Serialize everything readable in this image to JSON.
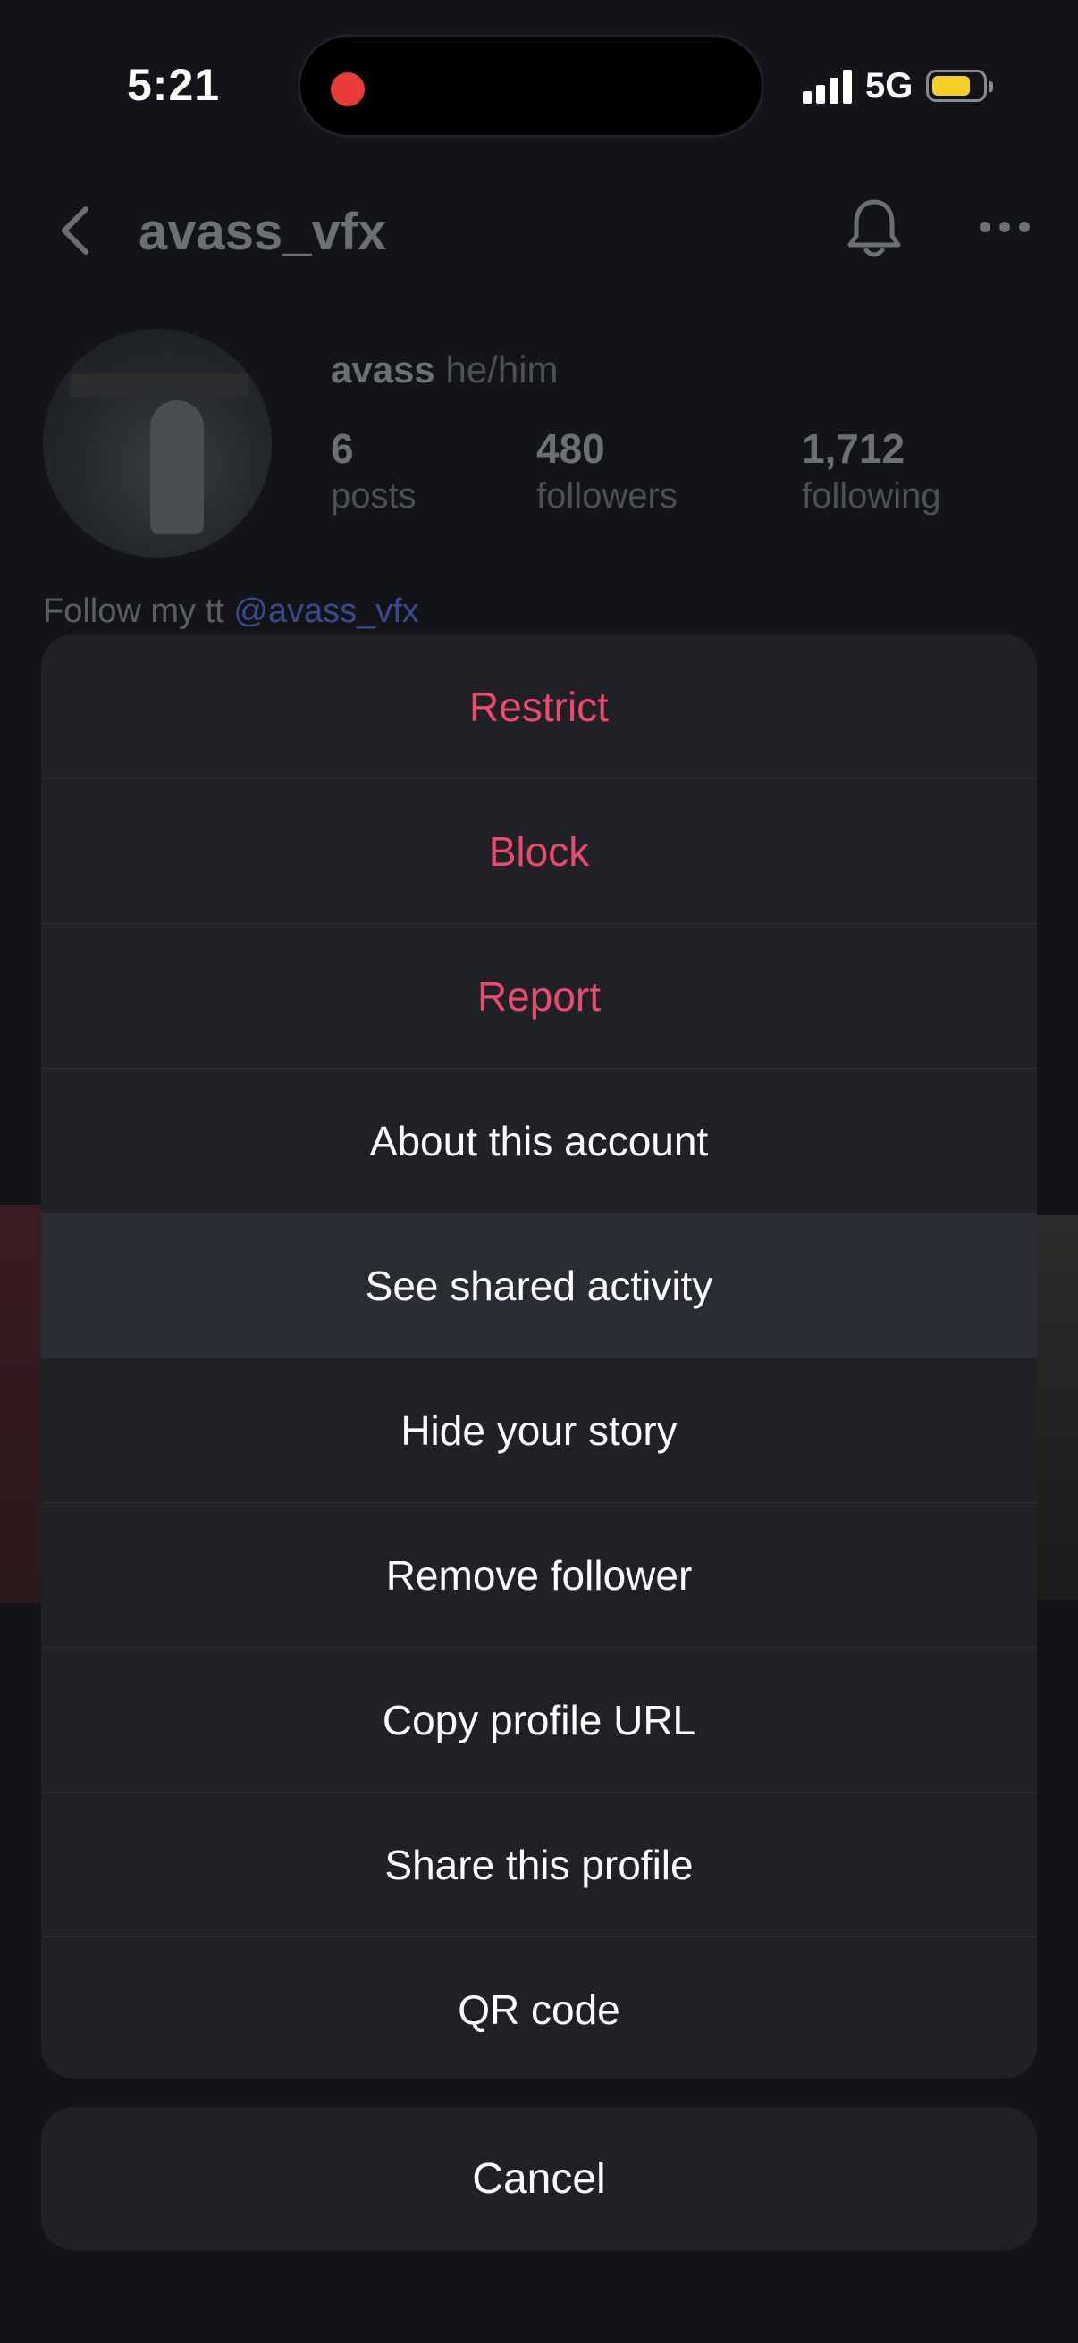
{
  "status_bar": {
    "time": "5:21",
    "network": "5G",
    "battery_level": 0.6,
    "battery_color": "#f5d125",
    "recording_color": "#ea3b3b"
  },
  "profile": {
    "username": "avass_vfx",
    "display_name": "avass",
    "pronouns": "he/him",
    "stats": [
      {
        "value": "6",
        "label": "posts"
      },
      {
        "value": "480",
        "label": "followers"
      },
      {
        "value": "1,712",
        "label": "following"
      }
    ],
    "bio_prefix": "Follow my tt",
    "bio_mention": "@avass_vfx",
    "icons": {
      "back": "chevron-left-icon",
      "notifications": "bell-icon",
      "more": "more-horizontal-icon"
    }
  },
  "action_sheet": {
    "items": [
      {
        "label": "Restrict",
        "style": "danger"
      },
      {
        "label": "Block",
        "style": "danger"
      },
      {
        "label": "Report",
        "style": "danger"
      },
      {
        "label": "About this account",
        "style": "normal"
      },
      {
        "label": "See shared activity",
        "style": "highlighted"
      },
      {
        "label": "Hide your story",
        "style": "normal"
      },
      {
        "label": "Remove follower",
        "style": "normal"
      },
      {
        "label": "Copy profile URL",
        "style": "normal"
      },
      {
        "label": "Share this profile",
        "style": "normal"
      },
      {
        "label": "QR code",
        "style": "normal"
      }
    ],
    "cancel_label": "Cancel",
    "danger_color": "#ed4a6f"
  }
}
